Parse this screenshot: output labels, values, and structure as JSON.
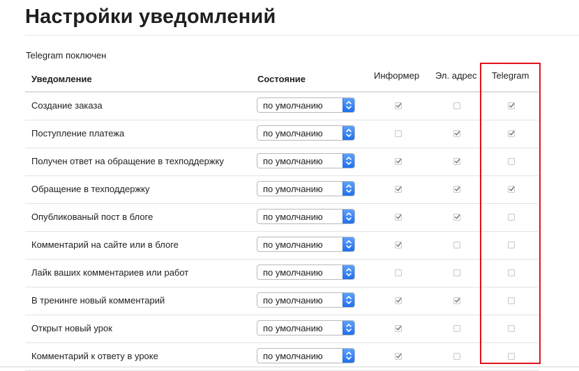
{
  "page": {
    "title": "Настройки уведомлений",
    "telegram_status": "Telegram поключен"
  },
  "table": {
    "columns": {
      "notification": "Уведомление",
      "state": "Состояние",
      "informer": "Информер",
      "email": "Эл. адрес",
      "telegram": "Telegram"
    },
    "rows": [
      {
        "label": "Создание заказа",
        "state": "по умолчанию",
        "informer": true,
        "email": false,
        "telegram": true
      },
      {
        "label": "Поступление платежа",
        "state": "по умолчанию",
        "informer": false,
        "email": true,
        "telegram": true
      },
      {
        "label": "Получен ответ на обращение в техподдержку",
        "state": "по умолчанию",
        "informer": true,
        "email": true,
        "telegram": false
      },
      {
        "label": "Обращение в техподдержку",
        "state": "по умолчанию",
        "informer": true,
        "email": true,
        "telegram": true
      },
      {
        "label": "Опубликованый пост в блоге",
        "state": "по умолчанию",
        "informer": true,
        "email": true,
        "telegram": false
      },
      {
        "label": "Комментарий на сайте или в блоге",
        "state": "по умолчанию",
        "informer": true,
        "email": false,
        "telegram": false
      },
      {
        "label": "Лайк ваших комментариев или работ",
        "state": "по умолчанию",
        "informer": false,
        "email": false,
        "telegram": false
      },
      {
        "label": "В тренинге новый комментарий",
        "state": "по умолчанию",
        "informer": true,
        "email": true,
        "telegram": false
      },
      {
        "label": "Открыт новый урок",
        "state": "по умолчанию",
        "informer": true,
        "email": false,
        "telegram": false
      },
      {
        "label": "Комментарий к ответу в уроке",
        "state": "по умолчанию",
        "informer": true,
        "email": false,
        "telegram": false
      }
    ]
  },
  "colors": {
    "highlight": "#e0131a",
    "select_arrow": "#1e6ff0"
  },
  "icons": {
    "select_arrow": "chevron-up-down-icon",
    "check": "checkmark-icon"
  }
}
